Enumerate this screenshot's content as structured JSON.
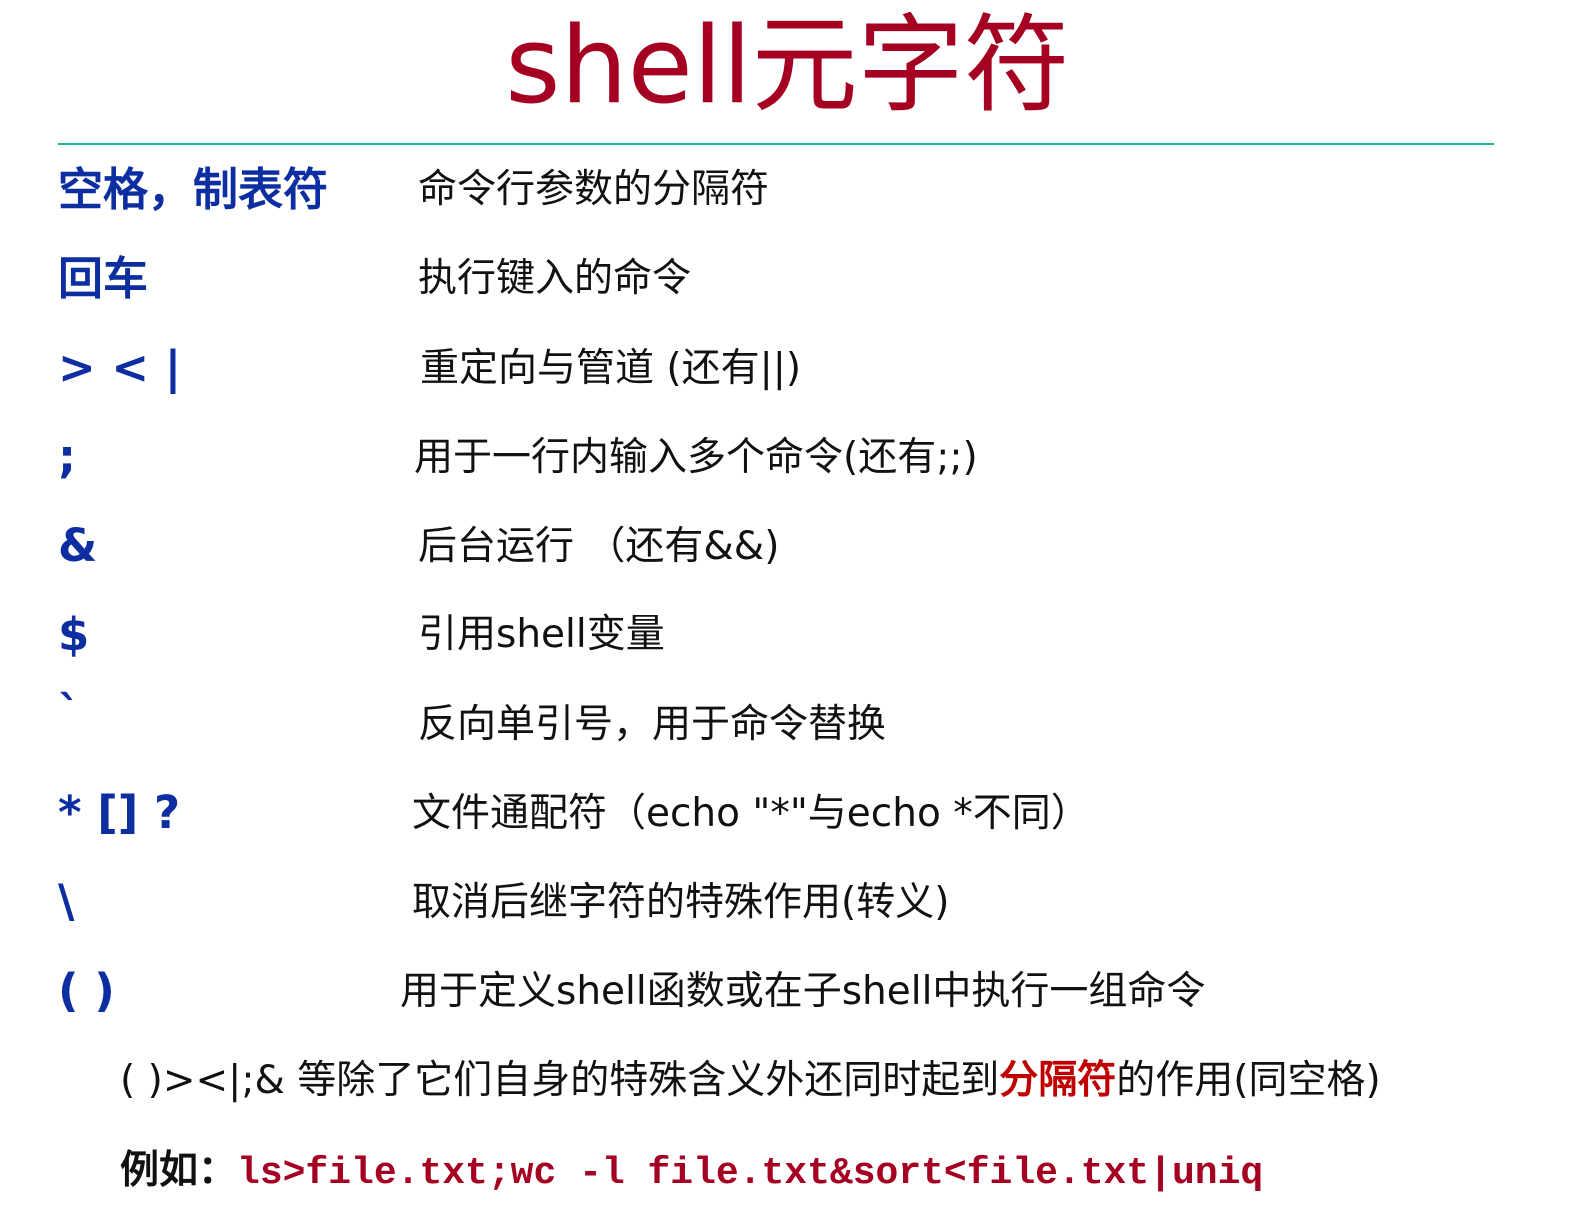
{
  "title": "shell元字符",
  "rows": [
    {
      "symbol": "空格，制表符",
      "desc": "命令行参数的分隔符"
    },
    {
      "symbol": "回车",
      "desc": "执行键入的命令"
    },
    {
      "symbol": "> < |",
      "desc": "重定向与管道 (还有||)"
    },
    {
      "symbol": ";",
      "desc": "用于一行内输入多个命令(还有;;)"
    },
    {
      "symbol": "&",
      "desc": "后台运行 （还有&&)"
    },
    {
      "symbol": "$",
      "desc": "引用shell变量"
    },
    {
      "symbol": "`",
      "desc": "反向单引号，用于命令替换"
    },
    {
      "symbol": "* [] ?",
      "desc": "文件通配符（echo \"*\"与echo *不同）"
    },
    {
      "symbol": "\\",
      "desc": "取消后继字符的特殊作用(转义)"
    },
    {
      "symbol": "( )",
      "desc": "用于定义shell函数或在子shell中执行一组命令"
    }
  ],
  "note": {
    "before": "( )><|;& 等除了它们自身的特殊含义外还同时起到",
    "highlight": "分隔符",
    "after": "的作用(同空格)"
  },
  "example": {
    "label": "例如：",
    "code": "ls>file.txt;wc -l file.txt&sort<file.txt|uniq"
  },
  "colors": {
    "title": "#a50021",
    "rule": "#1fb79a",
    "symbol": "#0d2ea0",
    "highlight": "#c00000",
    "code": "#a50021"
  }
}
